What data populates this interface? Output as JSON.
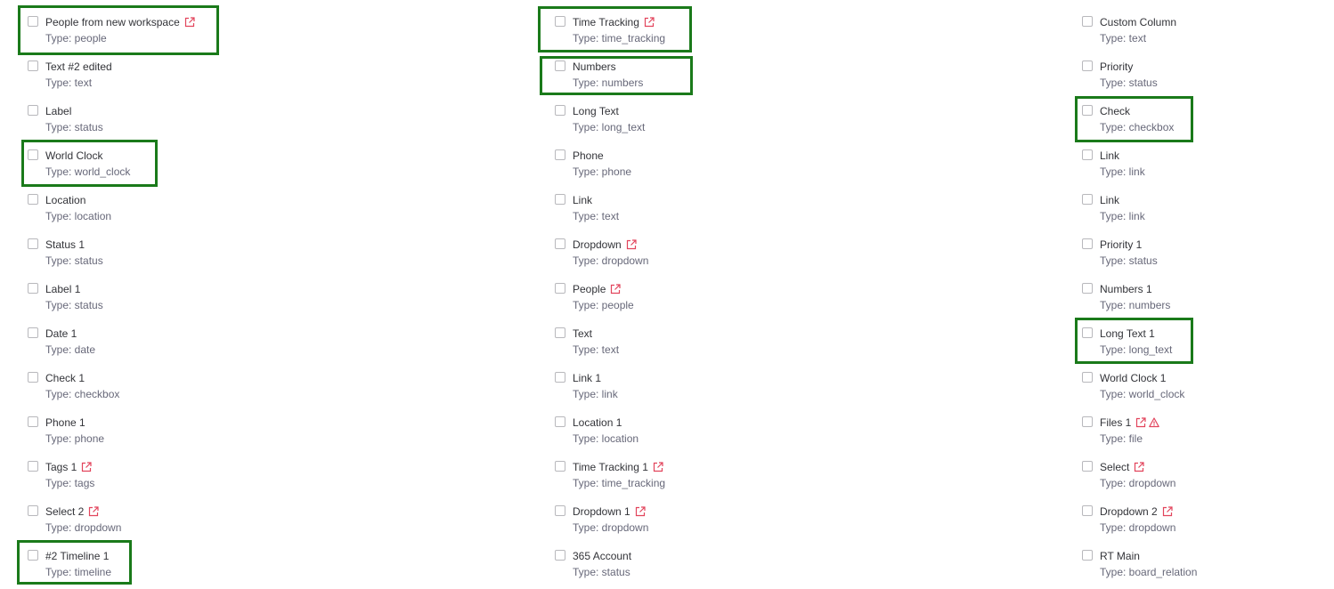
{
  "accent_colors": {
    "highlight": "#1a7a1a",
    "external_icon": "#e2445c",
    "text": "#323338",
    "subtext": "#676879"
  },
  "columns": [
    {
      "items": [
        {
          "name": "People from new workspace",
          "type": "Type: people",
          "icons": [
            "external-link-icon"
          ]
        },
        {
          "name": "Text #2 edited",
          "type": "Type: text",
          "icons": []
        },
        {
          "name": "Label",
          "type": "Type: status",
          "icons": []
        },
        {
          "name": "World Clock",
          "type": "Type: world_clock",
          "icons": []
        },
        {
          "name": "Location",
          "type": "Type: location",
          "icons": []
        },
        {
          "name": "Status 1",
          "type": "Type: status",
          "icons": []
        },
        {
          "name": "Label 1",
          "type": "Type: status",
          "icons": []
        },
        {
          "name": "Date 1",
          "type": "Type: date",
          "icons": []
        },
        {
          "name": "Check 1",
          "type": "Type: checkbox",
          "icons": []
        },
        {
          "name": "Phone 1",
          "type": "Type: phone",
          "icons": []
        },
        {
          "name": "Tags 1",
          "type": "Type: tags",
          "icons": [
            "external-link-icon"
          ]
        },
        {
          "name": "Select 2",
          "type": "Type: dropdown",
          "icons": [
            "external-link-icon"
          ]
        },
        {
          "name": "#2 Timeline 1",
          "type": "Type: timeline",
          "icons": []
        }
      ]
    },
    {
      "items": [
        {
          "name": "Time Tracking",
          "type": "Type: time_tracking",
          "icons": [
            "external-link-icon"
          ]
        },
        {
          "name": "Numbers",
          "type": "Type: numbers",
          "icons": []
        },
        {
          "name": "Long Text",
          "type": "Type: long_text",
          "icons": []
        },
        {
          "name": "Phone",
          "type": "Type: phone",
          "icons": []
        },
        {
          "name": "Link",
          "type": "Type: text",
          "icons": []
        },
        {
          "name": "Dropdown",
          "type": "Type: dropdown",
          "icons": [
            "external-link-icon"
          ]
        },
        {
          "name": "People",
          "type": "Type: people",
          "icons": [
            "external-link-icon"
          ]
        },
        {
          "name": "Text",
          "type": "Type: text",
          "icons": []
        },
        {
          "name": "Link 1",
          "type": "Type: link",
          "icons": []
        },
        {
          "name": "Location 1",
          "type": "Type: location",
          "icons": []
        },
        {
          "name": "Time Tracking 1",
          "type": "Type: time_tracking",
          "icons": [
            "external-link-icon"
          ]
        },
        {
          "name": "Dropdown 1",
          "type": "Type: dropdown",
          "icons": [
            "external-link-icon"
          ]
        },
        {
          "name": "365 Account",
          "type": "Type: status",
          "icons": []
        }
      ]
    },
    {
      "items": [
        {
          "name": "Custom Column",
          "type": "Type: text",
          "icons": []
        },
        {
          "name": "Priority",
          "type": "Type: status",
          "icons": []
        },
        {
          "name": "Check",
          "type": "Type: checkbox",
          "icons": []
        },
        {
          "name": "Link",
          "type": "Type: link",
          "icons": []
        },
        {
          "name": "Link",
          "type": "Type: link",
          "icons": []
        },
        {
          "name": "Priority 1",
          "type": "Type: status",
          "icons": []
        },
        {
          "name": "Numbers 1",
          "type": "Type: numbers",
          "icons": []
        },
        {
          "name": "Long Text 1",
          "type": "Type: long_text",
          "icons": []
        },
        {
          "name": "World Clock 1",
          "type": "Type: world_clock",
          "icons": []
        },
        {
          "name": "Files 1",
          "type": "Type: file",
          "icons": [
            "external-link-icon",
            "warning-icon"
          ]
        },
        {
          "name": "Select",
          "type": "Type: dropdown",
          "icons": [
            "external-link-icon"
          ]
        },
        {
          "name": "Dropdown 2",
          "type": "Type: dropdown",
          "icons": [
            "external-link-icon"
          ]
        },
        {
          "name": "RT Main",
          "type": "Type: board_relation",
          "icons": []
        }
      ]
    }
  ]
}
